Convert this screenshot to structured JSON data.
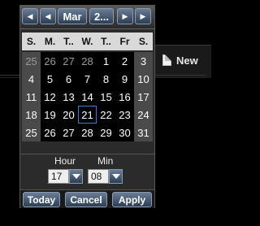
{
  "background": {
    "new_label": "New"
  },
  "calendar": {
    "month": "Mar",
    "year": "2...",
    "weekdays": [
      "S.",
      "M.",
      "T..",
      "W.",
      "T..",
      "Fr",
      "S."
    ],
    "weeks": [
      [
        "25",
        "26",
        "27",
        "28",
        "1",
        "2",
        "3"
      ],
      [
        "4",
        "5",
        "6",
        "7",
        "8",
        "9",
        "10"
      ],
      [
        "11",
        "12",
        "13",
        "14",
        "15",
        "16",
        "17"
      ],
      [
        "18",
        "19",
        "20",
        "21",
        "22",
        "23",
        "24"
      ],
      [
        "25",
        "26",
        "27",
        "28",
        "29",
        "30",
        "31"
      ]
    ],
    "today": "21",
    "hour_label": "Hour",
    "min_label": "Min",
    "hour_value": "17",
    "min_value": "08",
    "buttons": {
      "today": "Today",
      "cancel": "Cancel",
      "apply": "Apply"
    }
  }
}
